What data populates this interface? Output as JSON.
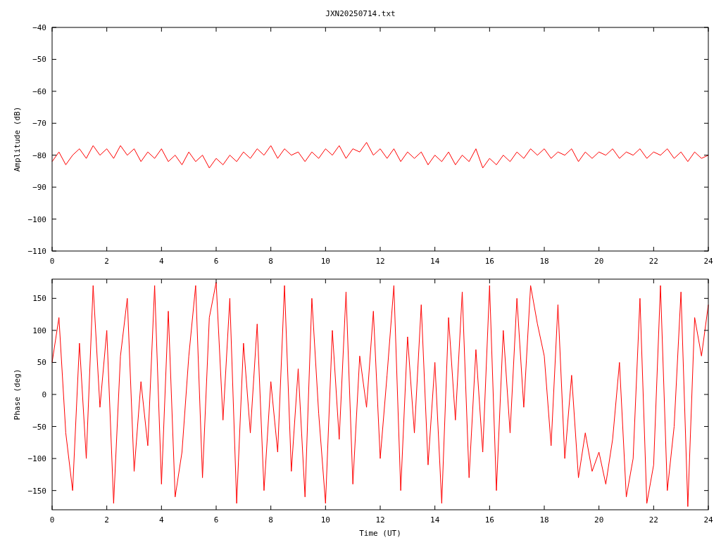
{
  "title": "JXN20250714.txt",
  "plots": [
    {
      "chart_data": {
        "type": "line",
        "ylabel": "Amplitude (dB)",
        "xlim": [
          0,
          24
        ],
        "ylim": [
          -110,
          -40
        ],
        "xticks": [
          0,
          2,
          4,
          6,
          8,
          10,
          12,
          14,
          16,
          18,
          20,
          22,
          24
        ],
        "yticks": [
          -110,
          -100,
          -90,
          -80,
          -70,
          -60,
          -50,
          -40
        ],
        "x": [
          0,
          0.25,
          0.5,
          0.75,
          1,
          1.25,
          1.5,
          1.75,
          2,
          2.25,
          2.5,
          2.75,
          3,
          3.25,
          3.5,
          3.75,
          4,
          4.25,
          4.5,
          4.75,
          5,
          5.25,
          5.5,
          5.75,
          6,
          6.25,
          6.5,
          6.75,
          7,
          7.25,
          7.5,
          7.75,
          8,
          8.25,
          8.5,
          8.75,
          9,
          9.25,
          9.5,
          9.75,
          10,
          10.25,
          10.5,
          10.75,
          11,
          11.25,
          11.5,
          11.75,
          12,
          12.25,
          12.5,
          12.75,
          13,
          13.25,
          13.5,
          13.75,
          14,
          14.25,
          14.5,
          14.75,
          15,
          15.25,
          15.5,
          15.75,
          16,
          16.25,
          16.5,
          16.75,
          17,
          17.25,
          17.5,
          17.75,
          18,
          18.25,
          18.5,
          18.75,
          19,
          19.25,
          19.5,
          19.75,
          20,
          20.25,
          20.5,
          20.75,
          21,
          21.25,
          21.5,
          21.75,
          22,
          22.25,
          22.5,
          22.75,
          23,
          23.25,
          23.5,
          23.75,
          24
        ],
        "series": [
          {
            "color": "#ff0000",
            "values": [
              -82,
              -79,
              -83,
              -80,
              -78,
              -81,
              -77,
              -80,
              -78,
              -81,
              -77,
              -80,
              -78,
              -82,
              -79,
              -81,
              -78,
              -82,
              -80,
              -83,
              -79,
              -82,
              -80,
              -84,
              -81,
              -83,
              -80,
              -82,
              -79,
              -81,
              -78,
              -80,
              -77,
              -81,
              -78,
              -80,
              -79,
              -82,
              -79,
              -81,
              -78,
              -80,
              -77,
              -81,
              -78,
              -79,
              -76,
              -80,
              -78,
              -81,
              -78,
              -82,
              -79,
              -81,
              -79,
              -83,
              -80,
              -82,
              -79,
              -83,
              -80,
              -82,
              -78,
              -84,
              -81,
              -83,
              -80,
              -82,
              -79,
              -81,
              -78,
              -80,
              -78,
              -81,
              -79,
              -80,
              -78,
              -82,
              -79,
              -81,
              -79,
              -80,
              -78,
              -81,
              -79,
              -80,
              -78,
              -81,
              -79,
              -80,
              -78,
              -81,
              -79,
              -82,
              -79,
              -81,
              -80
            ]
          }
        ]
      }
    },
    {
      "chart_data": {
        "type": "line",
        "xlabel": "Time (UT)",
        "ylabel": "Phase (deg)",
        "xlim": [
          0,
          24
        ],
        "ylim": [
          -180,
          180
        ],
        "xticks": [
          0,
          2,
          4,
          6,
          8,
          10,
          12,
          14,
          16,
          18,
          20,
          22,
          24
        ],
        "yticks": [
          -150,
          -100,
          -50,
          0,
          50,
          100,
          150
        ],
        "x": [
          0,
          0.25,
          0.5,
          0.75,
          1,
          1.25,
          1.5,
          1.75,
          2,
          2.25,
          2.5,
          2.75,
          3,
          3.25,
          3.5,
          3.75,
          4,
          4.25,
          4.5,
          4.75,
          5,
          5.25,
          5.5,
          5.75,
          6,
          6.25,
          6.5,
          6.75,
          7,
          7.25,
          7.5,
          7.75,
          8,
          8.25,
          8.5,
          8.75,
          9,
          9.25,
          9.5,
          9.75,
          10,
          10.25,
          10.5,
          10.75,
          11,
          11.25,
          11.5,
          11.75,
          12,
          12.25,
          12.5,
          12.75,
          13,
          13.25,
          13.5,
          13.75,
          14,
          14.25,
          14.5,
          14.75,
          15,
          15.25,
          15.5,
          15.75,
          16,
          16.25,
          16.5,
          16.75,
          17,
          17.25,
          17.5,
          17.75,
          18,
          18.25,
          18.5,
          18.75,
          19,
          19.25,
          19.5,
          19.75,
          20,
          20.25,
          20.5,
          20.75,
          21,
          21.25,
          21.5,
          21.75,
          22,
          22.25,
          22.5,
          22.75,
          23,
          23.25,
          23.5,
          23.75,
          24
        ],
        "series": [
          {
            "color": "#ff0000",
            "values": [
              50,
              120,
              -60,
              -150,
              80,
              -100,
              170,
              -20,
              100,
              -170,
              60,
              150,
              -120,
              20,
              -80,
              170,
              -140,
              130,
              -160,
              -90,
              60,
              170,
              -130,
              120,
              175,
              -40,
              150,
              -170,
              80,
              -60,
              110,
              -150,
              20,
              -90,
              170,
              -120,
              40,
              -160,
              150,
              -30,
              -170,
              100,
              -70,
              160,
              -140,
              60,
              -20,
              130,
              -100,
              30,
              170,
              -150,
              90,
              -60,
              140,
              -110,
              50,
              -170,
              120,
              -40,
              160,
              -130,
              70,
              -90,
              170,
              -150,
              100,
              -60,
              150,
              -20,
              170,
              110,
              60,
              -80,
              140,
              -100,
              30,
              -130,
              -60,
              -120,
              -90,
              -140,
              -70,
              50,
              -160,
              -100,
              150,
              -170,
              -110,
              170,
              -150,
              -50,
              160,
              -175,
              120,
              60,
              140
            ]
          }
        ]
      }
    }
  ]
}
